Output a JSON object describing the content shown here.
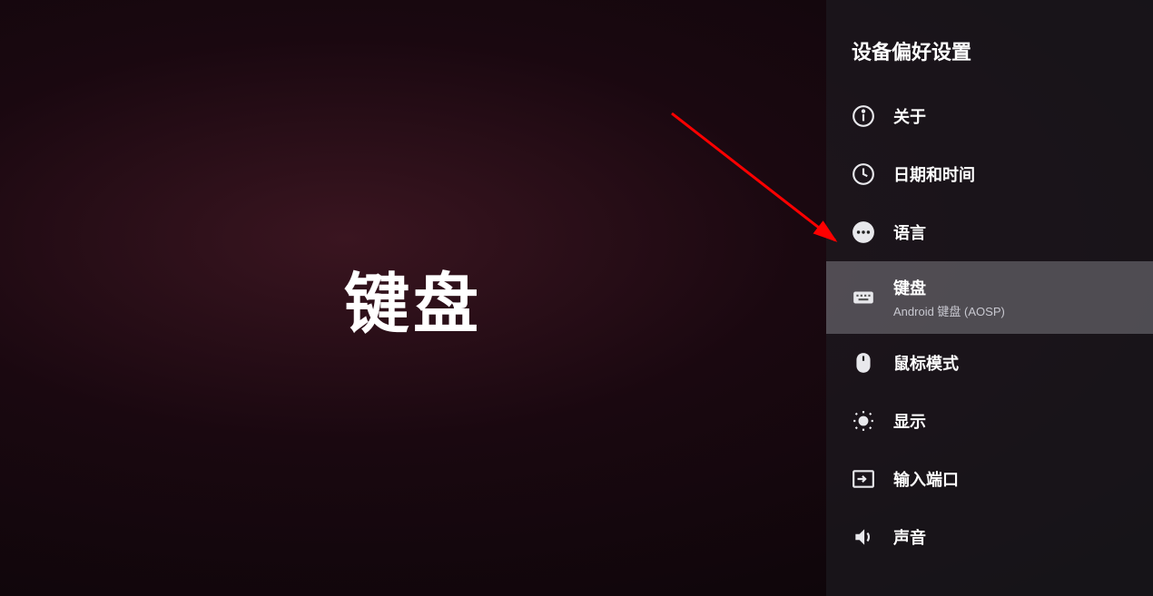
{
  "main": {
    "title": "键盘"
  },
  "sidebar": {
    "header": "设备偏好设置",
    "items": [
      {
        "label": "关于",
        "sublabel": null,
        "icon": "info",
        "selected": false
      },
      {
        "label": "日期和时间",
        "sublabel": null,
        "icon": "clock",
        "selected": false
      },
      {
        "label": "语言",
        "sublabel": null,
        "icon": "dots",
        "selected": false
      },
      {
        "label": "键盘",
        "sublabel": "Android 键盘 (AOSP)",
        "icon": "keyboard",
        "selected": true
      },
      {
        "label": "鼠标模式",
        "sublabel": null,
        "icon": "mouse",
        "selected": false
      },
      {
        "label": "显示",
        "sublabel": null,
        "icon": "brightness",
        "selected": false
      },
      {
        "label": "输入端口",
        "sublabel": null,
        "icon": "input",
        "selected": false
      },
      {
        "label": "声音",
        "sublabel": null,
        "icon": "sound",
        "selected": false
      }
    ]
  }
}
